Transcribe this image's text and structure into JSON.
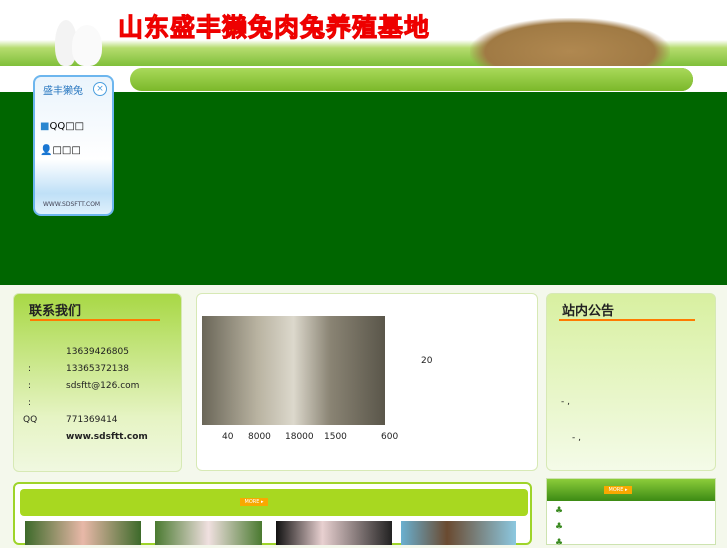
{
  "header": {
    "title": "山东盛丰獭兔肉兔养殖基地"
  },
  "float_panel": {
    "title": "盛丰獭兔",
    "close_icon": "close-icon",
    "qq_label": "QQ□□",
    "service_label": "□□□",
    "url": "WWW.SDSFTT.COM"
  },
  "contact": {
    "title": "联系我们",
    "rows": [
      {
        "label": "",
        "value": "13639426805"
      },
      {
        "label": ":",
        "value": "13365372138"
      },
      {
        "label": ":",
        "value": "sdsftt@126.com"
      },
      {
        "label": ":",
        "value": ""
      },
      {
        "label": "QQ",
        "value": "771369414"
      },
      {
        "label": "",
        "value": "www.sdsftt.com"
      }
    ]
  },
  "intro": {
    "side_text": "20",
    "numbers": [
      "40",
      "8000",
      "18000",
      "1500",
      "600"
    ]
  },
  "notice": {
    "title": "站内公告",
    "lines": [
      "-       ,",
      "-       ,"
    ]
  },
  "products": {
    "more_label": "MORE ▸"
  },
  "news": {
    "more_label": "MORE ▸",
    "bullets": [
      "♣",
      "♣",
      "♣"
    ]
  }
}
